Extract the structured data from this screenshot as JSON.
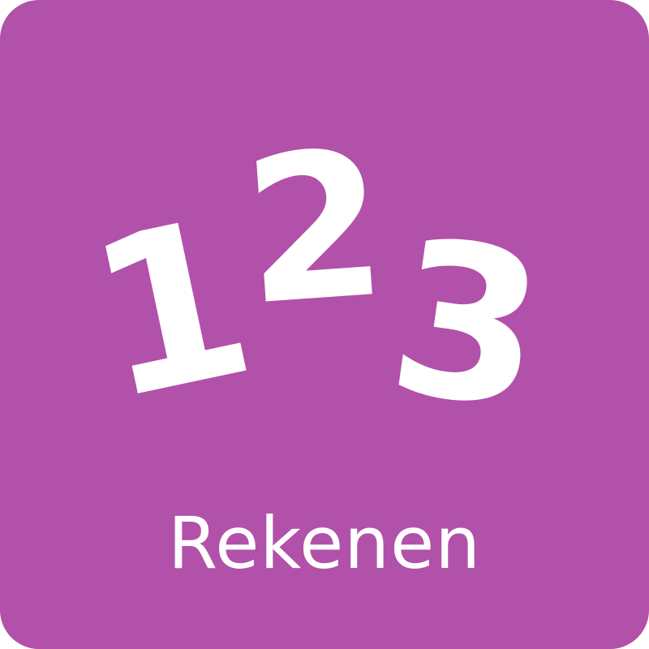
{
  "tile": {
    "background_color": "#b251a9",
    "digits": [
      "1",
      "2",
      "3"
    ],
    "label": "Rekenen",
    "text_color": "#ffffff"
  }
}
